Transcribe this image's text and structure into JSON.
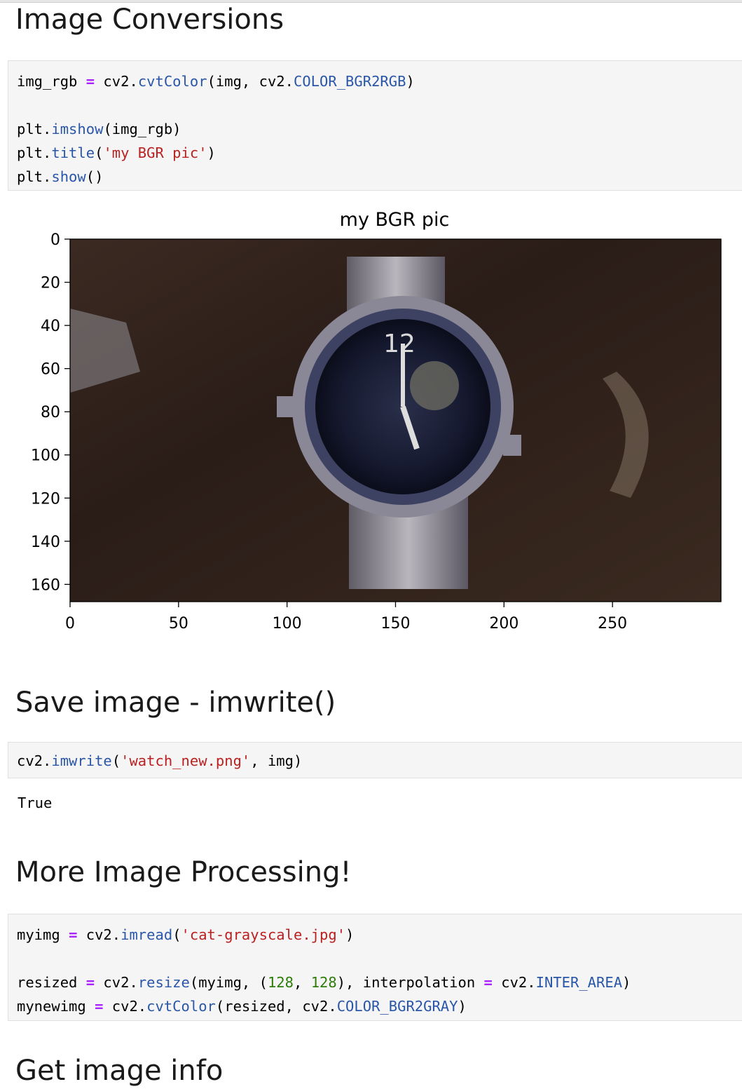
{
  "headings": {
    "conversions": "Image Conversions",
    "save": "Save image - imwrite()",
    "more": "More Image Processing!",
    "info": "Get image info"
  },
  "cells": {
    "convert": [
      [
        {
          "t": "img_rgb ",
          "c": ""
        },
        {
          "t": "=",
          "c": "op"
        },
        {
          "t": " cv2.",
          "c": ""
        },
        {
          "t": "cvtColor",
          "c": "fn"
        },
        {
          "t": "(img, cv2.",
          "c": ""
        },
        {
          "t": "COLOR_BGR2RGB",
          "c": "fn"
        },
        {
          "t": ")",
          "c": ""
        }
      ],
      [],
      [
        {
          "t": "plt.",
          "c": ""
        },
        {
          "t": "imshow",
          "c": "fn"
        },
        {
          "t": "(img_rgb)",
          "c": ""
        }
      ],
      [
        {
          "t": "plt.",
          "c": ""
        },
        {
          "t": "title",
          "c": "fn"
        },
        {
          "t": "(",
          "c": ""
        },
        {
          "t": "'my BGR pic'",
          "c": "str"
        },
        {
          "t": ")",
          "c": ""
        }
      ],
      [
        {
          "t": "plt.",
          "c": ""
        },
        {
          "t": "show",
          "c": "fn"
        },
        {
          "t": "()",
          "c": ""
        }
      ]
    ],
    "save": [
      [
        {
          "t": "cv2.",
          "c": ""
        },
        {
          "t": "imwrite",
          "c": "fn"
        },
        {
          "t": "(",
          "c": ""
        },
        {
          "t": "'watch_new.png'",
          "c": "str"
        },
        {
          "t": ", img)",
          "c": ""
        }
      ]
    ],
    "more": [
      [
        {
          "t": "myimg ",
          "c": ""
        },
        {
          "t": "=",
          "c": "op"
        },
        {
          "t": " cv2.",
          "c": ""
        },
        {
          "t": "imread",
          "c": "fn"
        },
        {
          "t": "(",
          "c": ""
        },
        {
          "t": "'cat-grayscale.jpg'",
          "c": "str"
        },
        {
          "t": ")",
          "c": ""
        }
      ],
      [],
      [
        {
          "t": "resized ",
          "c": ""
        },
        {
          "t": "=",
          "c": "op"
        },
        {
          "t": " cv2.",
          "c": ""
        },
        {
          "t": "resize",
          "c": "fn"
        },
        {
          "t": "(myimg, (",
          "c": ""
        },
        {
          "t": "128",
          "c": "num"
        },
        {
          "t": ", ",
          "c": ""
        },
        {
          "t": "128",
          "c": "num"
        },
        {
          "t": "), interpolation ",
          "c": ""
        },
        {
          "t": "=",
          "c": "op"
        },
        {
          "t": " cv2.",
          "c": ""
        },
        {
          "t": "INTER_AREA",
          "c": "fn"
        },
        {
          "t": ")",
          "c": ""
        }
      ],
      [
        {
          "t": "mynewimg ",
          "c": ""
        },
        {
          "t": "=",
          "c": "op"
        },
        {
          "t": " cv2.",
          "c": ""
        },
        {
          "t": "cvtColor",
          "c": "fn"
        },
        {
          "t": "(resized, cv2.",
          "c": ""
        },
        {
          "t": "COLOR_BGR2GRAY",
          "c": "fn"
        },
        {
          "t": ")",
          "c": ""
        }
      ]
    ]
  },
  "outputs": {
    "save_result": "True"
  },
  "chart_data": {
    "type": "image",
    "title": "my BGR pic",
    "xlim": [
      0,
      300
    ],
    "ylim": [
      168,
      0
    ],
    "xticks": [
      0,
      50,
      100,
      150,
      200,
      250
    ],
    "yticks": [
      0,
      20,
      40,
      60,
      80,
      100,
      120,
      140,
      160
    ],
    "image_content": "wristwatch-photo"
  }
}
